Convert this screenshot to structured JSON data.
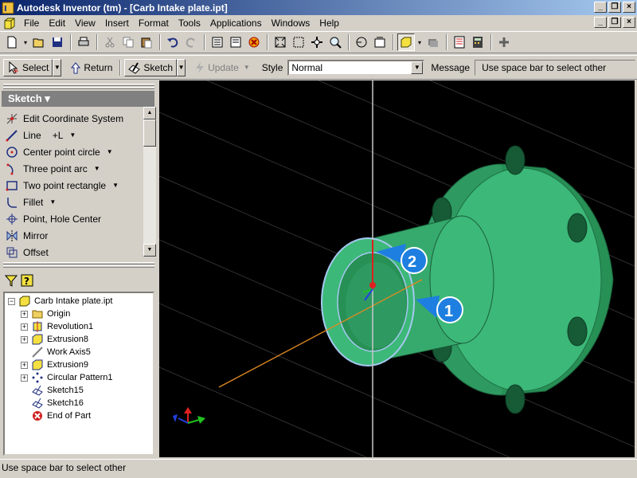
{
  "window": {
    "title": "Autodesk Inventor (tm) - [Carb Intake plate.ipt]"
  },
  "menu": {
    "items": [
      "File",
      "Edit",
      "View",
      "Insert",
      "Format",
      "Tools",
      "Applications",
      "Windows",
      "Help"
    ]
  },
  "command_bar": {
    "select_label": "Select",
    "return_label": "Return",
    "sketch_label": "Sketch",
    "update_label": "Update",
    "style_label": "Style",
    "style_value": "Normal",
    "message_label": "Message",
    "message_value": "Use space bar to select other"
  },
  "sketch_panel": {
    "header": "Sketch ▾",
    "items": [
      {
        "label": "Edit Coordinate System",
        "icon": "coordinate-system-icon"
      },
      {
        "label": "Line",
        "shortcut": "+L",
        "icon": "line-icon",
        "dropdown": true
      },
      {
        "label": "Center point circle",
        "icon": "circle-icon",
        "dropdown": true
      },
      {
        "label": "Three point arc",
        "icon": "arc-icon",
        "dropdown": true
      },
      {
        "label": "Two point rectangle",
        "icon": "rectangle-icon",
        "dropdown": true
      },
      {
        "label": "Fillet",
        "icon": "fillet-icon",
        "dropdown": true
      },
      {
        "label": "Point, Hole Center",
        "icon": "point-icon"
      },
      {
        "label": "Mirror",
        "icon": "mirror-icon"
      },
      {
        "label": "Offset",
        "icon": "offset-icon"
      }
    ]
  },
  "browser": {
    "root": "Carb Intake plate.ipt",
    "items": [
      {
        "label": "Origin",
        "icon": "folder-icon",
        "expandable": true
      },
      {
        "label": "Revolution1",
        "icon": "revolve-icon",
        "expandable": true
      },
      {
        "label": "Extrusion8",
        "icon": "extrude-icon",
        "expandable": true
      },
      {
        "label": "Work Axis5",
        "icon": "work-axis-icon",
        "expandable": false
      },
      {
        "label": "Extrusion9",
        "icon": "extrude-icon",
        "expandable": true
      },
      {
        "label": "Circular Pattern1",
        "icon": "circular-pattern-icon",
        "expandable": true
      },
      {
        "label": "Sketch15",
        "icon": "sketch-icon",
        "expandable": false
      },
      {
        "label": "Sketch16",
        "icon": "sketch-icon",
        "expandable": false
      },
      {
        "label": "End of Part",
        "icon": "end-of-part-icon",
        "expandable": false
      }
    ]
  },
  "viewport": {
    "callouts": [
      "1",
      "2"
    ]
  },
  "status": {
    "text": "Use space bar to select other"
  },
  "colors": {
    "titlebar_start": "#0a246a",
    "titlebar_end": "#a6caf0",
    "part_green": "#3cb878",
    "viewport_bg": "#000000",
    "callout_blue": "#1e7fe0"
  }
}
